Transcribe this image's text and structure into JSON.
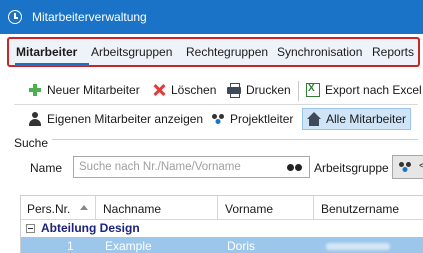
{
  "window": {
    "title": "Mitarbeiterverwaltung"
  },
  "menu": {
    "items": [
      {
        "label": "Mitarbeiter"
      },
      {
        "label": "Arbeitsgruppen"
      },
      {
        "label": "Rechtegruppen"
      },
      {
        "label": "Synchronisation"
      },
      {
        "label": "Reports"
      }
    ],
    "active": "Mitarbeiter"
  },
  "toolbar": {
    "row1": [
      {
        "label": "Neuer Mitarbeiter",
        "icon": "plus-icon"
      },
      {
        "label": "Löschen",
        "icon": "x-icon"
      },
      {
        "label": "Drucken",
        "icon": "printer-icon"
      },
      {
        "label": "Export nach Excel",
        "icon": "excel-icon"
      }
    ],
    "row2": [
      {
        "label": "Eigenen Mitarbeiter anzeigen",
        "icon": "person-icon"
      },
      {
        "label": "Projektleiter",
        "icon": "group-icon"
      },
      {
        "label": "Alle Mitarbeiter",
        "icon": "home-icon",
        "selected": true
      }
    ]
  },
  "search": {
    "section_label": "Suche",
    "name_label": "Name",
    "name_placeholder": "Suche nach Nr./Name/Vorname",
    "group_label": "Arbeitsgruppe",
    "group_caret": "<"
  },
  "grid": {
    "columns": [
      {
        "label": "Pers.Nr."
      },
      {
        "label": "Nachname"
      },
      {
        "label": "Vorname"
      },
      {
        "label": "Benutzername"
      }
    ],
    "groups": [
      {
        "label": "Abteilung Design",
        "rows": [
          {
            "nr": "1",
            "nachname": "Example",
            "vorname": "Doris",
            "benutzername": "",
            "selected": true
          }
        ]
      }
    ]
  },
  "colors": {
    "titlebar": "#1a73c6",
    "menu_highlight_border": "#c62828",
    "selected_row": "#9cc7ea",
    "group_text": "#1a237e"
  }
}
